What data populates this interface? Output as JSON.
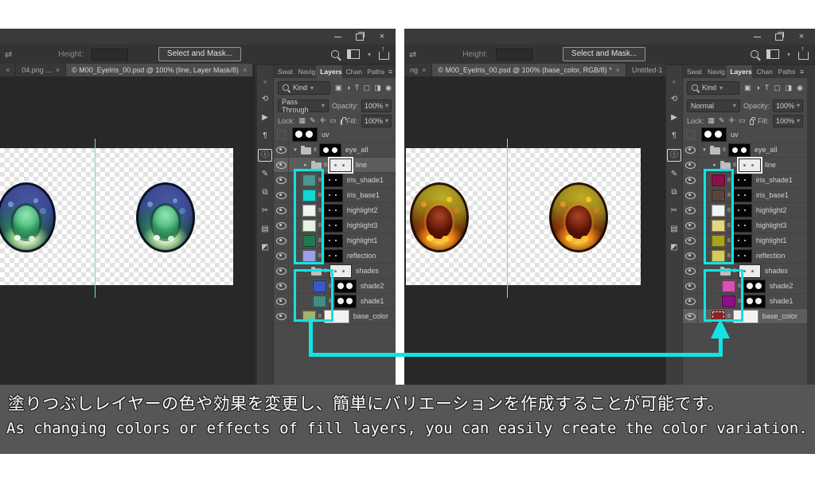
{
  "accent_color": "#15E2E2",
  "guide_color": "#6FDCD8",
  "caption": {
    "jp": "塗りつぶしレイヤーの色や効果を変更し、簡単にバリエーションを作成することが可能です。",
    "en": "As changing colors or effects of fill layers, you can easily create the color variation."
  },
  "icons": {
    "chain": "8",
    "chevron_open": "▾",
    "chevron_closed": "▸",
    "hamburger": "≡",
    "dropdown": "▾",
    "overflow": "»",
    "collapse": "«",
    "transform": "⇄",
    "close": "×",
    "filter_icons": [
      "▣",
      "◑",
      "T",
      "▢",
      "◨"
    ],
    "filter_latch": "◉",
    "lock_icons": [
      "▦",
      "✎",
      "✛",
      "▭"
    ],
    "dock_icons": [
      {
        "name": "history",
        "glyph": "⟲"
      },
      {
        "name": "actions",
        "glyph": "▶"
      },
      {
        "name": "character",
        "glyph": "¶"
      },
      {
        "name": "info",
        "glyph": "ⓘ",
        "active": true
      },
      {
        "name": "brush-settings",
        "glyph": "✎"
      },
      {
        "name": "clone-source",
        "glyph": "⧉"
      },
      {
        "name": "tool-presets",
        "glyph": "✂"
      },
      {
        "name": "libraries",
        "glyph": "▤"
      },
      {
        "name": "adjustments",
        "glyph": "◩"
      }
    ]
  },
  "shared": {
    "options": {
      "height_label": "Height:",
      "height_value": "",
      "select_mask": "Select and Mask..."
    },
    "panel": {
      "tabs": [
        "Swat",
        "Navig",
        "Layers",
        "Chan",
        "Paths"
      ],
      "filter_label": "Kind",
      "opacity_label": "Opacity:",
      "opacity_value": "100%",
      "lock_label": "Lock:",
      "fill_label": "Fill:",
      "fill_value": "100%"
    }
  },
  "left_window": {
    "tabs": [
      {
        "label": "",
        "close": "×"
      },
      {
        "label": "04.png ...",
        "close": "×"
      },
      {
        "label": "© M00_EyeIris_00.psd @ 100% (line, Layer Mask/8)",
        "close": "×"
      }
    ],
    "blend_mode": "Pass Through",
    "layers": [
      {
        "name": "uv",
        "kind": "uv",
        "indent": 0,
        "eye": false
      },
      {
        "name": "eye_all",
        "kind": "group-open",
        "indent": 0,
        "thumb": "dark"
      },
      {
        "name": "line",
        "kind": "group-closed",
        "indent": 1,
        "thumb": "light",
        "outlined": true,
        "selected": true
      },
      {
        "name": "iris_shade1",
        "kind": "fill",
        "indent": 1,
        "color": "#4E9590",
        "mask": "dark"
      },
      {
        "name": "iris_base1",
        "kind": "fill",
        "indent": 1,
        "color": "#13D8D2",
        "mask": "dark"
      },
      {
        "name": "highlight2",
        "kind": "fill",
        "indent": 1,
        "color": "#F2F4F1",
        "mask": "dark"
      },
      {
        "name": "highlight3",
        "kind": "fill",
        "indent": 1,
        "color": "#E4F2E2",
        "mask": "dark"
      },
      {
        "name": "highlight1",
        "kind": "fill",
        "indent": 1,
        "color": "#207A4D",
        "mask": "dark"
      },
      {
        "name": "reflection",
        "kind": "fill",
        "indent": 1,
        "color": "#9BA0E5",
        "mask": "dark"
      },
      {
        "name": "shades",
        "kind": "group-open",
        "indent": 1,
        "thumb": "light"
      },
      {
        "name": "shade2",
        "kind": "fill",
        "indent": 2,
        "color": "#3A58C4",
        "mask": "eyes"
      },
      {
        "name": "shade1",
        "kind": "fill",
        "indent": 2,
        "color": "#418D85",
        "mask": "eyes"
      },
      {
        "name": "base_color",
        "kind": "fill",
        "indent": 1,
        "color": "#A6B06A",
        "mask": "white"
      }
    ]
  },
  "right_window": {
    "tabs": [
      {
        "label": "ng",
        "close": "×"
      },
      {
        "label": "© M00_EyeIris_00.psd @ 100% (base_color, RGB/8) *",
        "close": "×"
      },
      {
        "label": "Untitled-1",
        "close": ""
      }
    ],
    "blend_mode": "Normal",
    "layers": [
      {
        "name": "uv",
        "kind": "uv",
        "indent": 0,
        "eye": false
      },
      {
        "name": "eye_all",
        "kind": "group-open",
        "indent": 0,
        "thumb": "dark"
      },
      {
        "name": "line",
        "kind": "group-closed",
        "indent": 1,
        "thumb": "light",
        "outlined": true
      },
      {
        "name": "iris_shade1",
        "kind": "fill",
        "indent": 1,
        "color": "#8E1049",
        "mask": "dark"
      },
      {
        "name": "iris_base1",
        "kind": "fill",
        "indent": 1,
        "color": "#5C443C",
        "mask": "dark"
      },
      {
        "name": "highlight2",
        "kind": "fill",
        "indent": 1,
        "color": "#F2F4F1",
        "mask": "dark"
      },
      {
        "name": "highlight3",
        "kind": "fill",
        "indent": 1,
        "color": "#E5D685",
        "mask": "dark"
      },
      {
        "name": "highlight1",
        "kind": "fill",
        "indent": 1,
        "color": "#A6A41E",
        "mask": "dark"
      },
      {
        "name": "reflection",
        "kind": "fill",
        "indent": 1,
        "color": "#D8C95E",
        "mask": "dark"
      },
      {
        "name": "shades",
        "kind": "group-open",
        "indent": 1,
        "thumb": "light"
      },
      {
        "name": "shade2",
        "kind": "fill",
        "indent": 2,
        "color": "#D553B5",
        "mask": "eyes"
      },
      {
        "name": "shade1",
        "kind": "fill",
        "indent": 2,
        "color": "#8C1188",
        "mask": "eyes"
      },
      {
        "name": "base_color",
        "kind": "fill",
        "indent": 1,
        "color": "#8E2222",
        "mask": "white",
        "selected": true,
        "editing": true
      }
    ]
  }
}
